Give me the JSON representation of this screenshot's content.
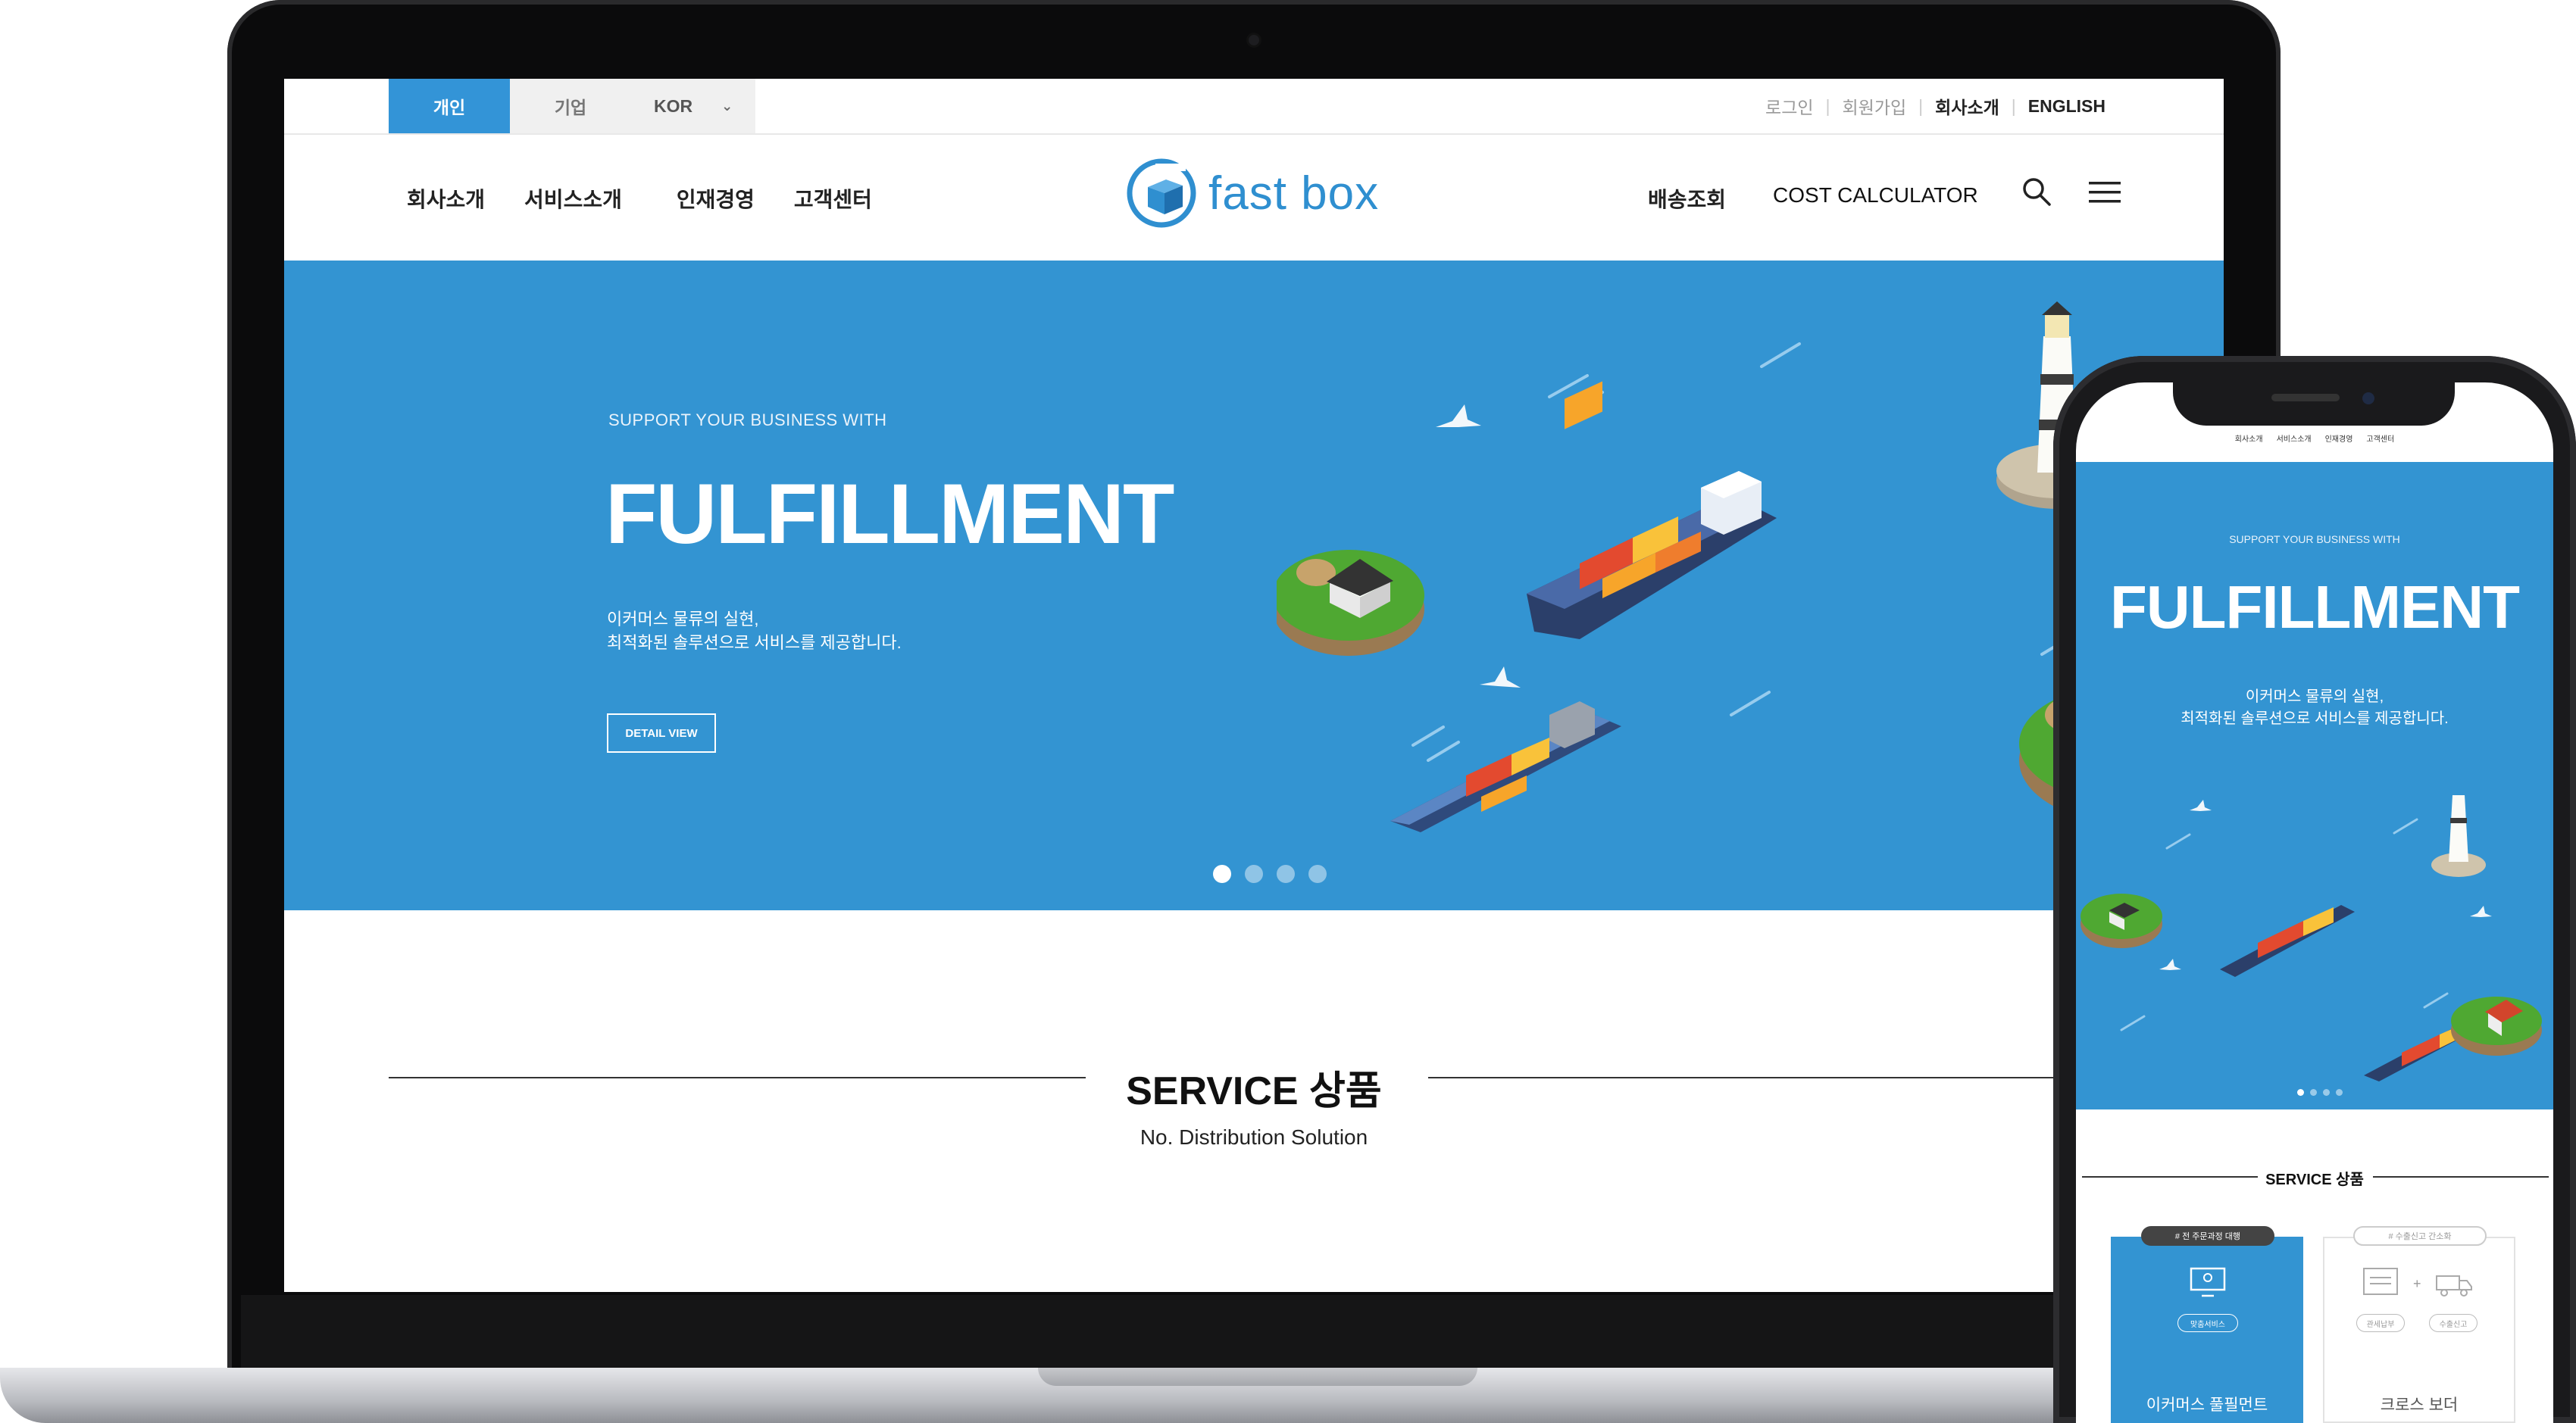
{
  "topbar": {
    "segments": [
      "개인",
      "기업"
    ],
    "language": "KOR",
    "links": [
      "로그인",
      "회원가입",
      "회사소개",
      "ENGLISH"
    ]
  },
  "nav": {
    "left": [
      "회사소개",
      "서비스소개",
      "인재경영",
      "고객센터"
    ],
    "right": [
      "배송조회",
      "COST CALCULATOR"
    ]
  },
  "logo": {
    "text": "fast box"
  },
  "hero": {
    "kicker": "SUPPORT YOUR BUSINESS WITH",
    "title": "FULFILLMENT",
    "desc_line1": "이커머스 물류의 실현,",
    "desc_line2": "최적화된 솔루션으로 서비스를 제공합니다.",
    "button": "DETAIL VIEW",
    "slides": 4,
    "active_slide": 1
  },
  "service": {
    "title": "SERVICE 상품",
    "subtitle": "No. Distribution Solution"
  },
  "phone": {
    "nav": [
      "회사소개",
      "서비스소개",
      "인재경영",
      "고객센터"
    ],
    "hero": {
      "kicker": "SUPPORT YOUR BUSINESS WITH",
      "title": "FULFILLMENT",
      "desc_line1": "이커머스 물류의 실현,",
      "desc_line2": "최적화된 솔루션으로 서비스를 제공합니다."
    },
    "service_title": "SERVICE 상품",
    "cards": [
      {
        "tag": "# 전 주문과정 대행",
        "pill": "맞춤서비스",
        "label": "이커머스 풀필먼트"
      },
      {
        "tag": "# 수출신고 간소화",
        "pill_a": "관세납부",
        "pill_b": "수출신고",
        "label": "크로스 보더"
      }
    ]
  },
  "colors": {
    "brand_blue": "#3394d2",
    "hero_bg": "#3394d2",
    "segment_active": "#3394d7"
  }
}
